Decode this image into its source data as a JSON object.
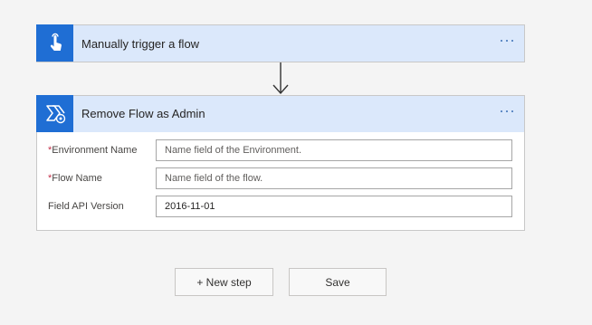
{
  "trigger": {
    "title": "Manually trigger a flow",
    "icon": "touch-hand-icon",
    "accent": "#1f6ed4"
  },
  "action": {
    "title": "Remove Flow as Admin",
    "icon": "power-automate-admin-icon",
    "fields": [
      {
        "label": "Environment Name",
        "required": "*",
        "value": "",
        "placeholder": "Name field of the Environment."
      },
      {
        "label": "Flow Name",
        "required": "*",
        "value": "",
        "placeholder": "Name field of the flow."
      },
      {
        "label": "Field API Version",
        "required": "",
        "value": "2016-11-01",
        "placeholder": ""
      }
    ]
  },
  "buttons": {
    "new_step": "+ New step",
    "save": "Save"
  },
  "colors": {
    "header_bg": "#dbe8fb",
    "icon_bg": "#1f6ed4",
    "required": "#c4314b"
  }
}
